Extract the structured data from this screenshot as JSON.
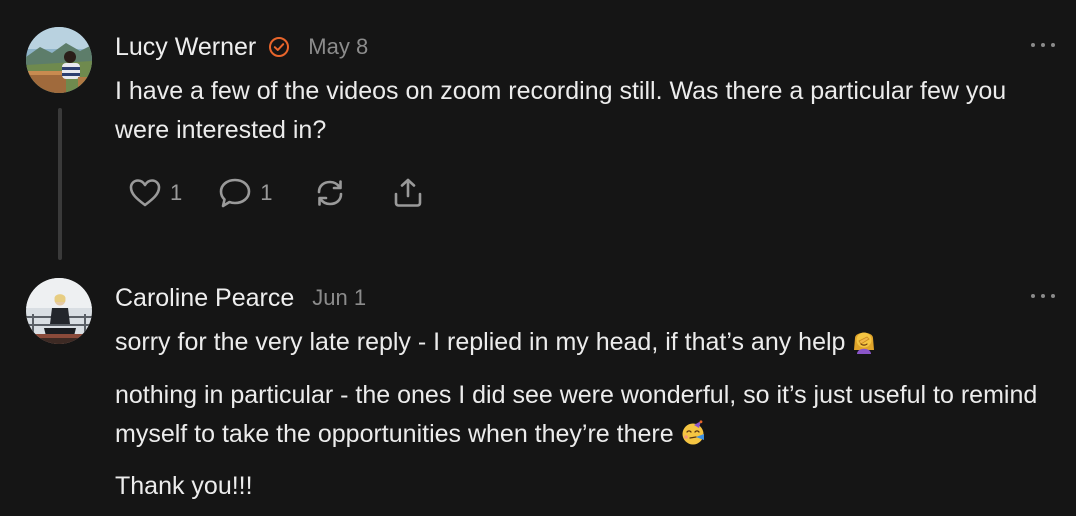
{
  "comments": [
    {
      "author": "Lucy Werner",
      "verified": true,
      "date": "May 8",
      "body": "I have a few of the videos on zoom recording still. Was there a particular few you were interested in?",
      "likes": "1",
      "replies": "1",
      "avatar": "landscape-photo-avatar"
    },
    {
      "author": "Caroline Pearce",
      "date": "Jun 1",
      "paragraphs": [
        "sorry for the very late reply - I replied in my head, if that’s any help",
        "nothing in particular - the ones I did see were wonderful, so it’s just useful to remind myself to take the opportunities when they’re there",
        "Thank you!!!"
      ],
      "emojis": [
        "facepalm-emoji",
        "party-face-emoji"
      ],
      "avatar": "seated-person-photo-avatar"
    }
  ],
  "colors": {
    "background": "#151515",
    "verified_badge": "#e8652b",
    "muted": "#8c8c8c"
  }
}
